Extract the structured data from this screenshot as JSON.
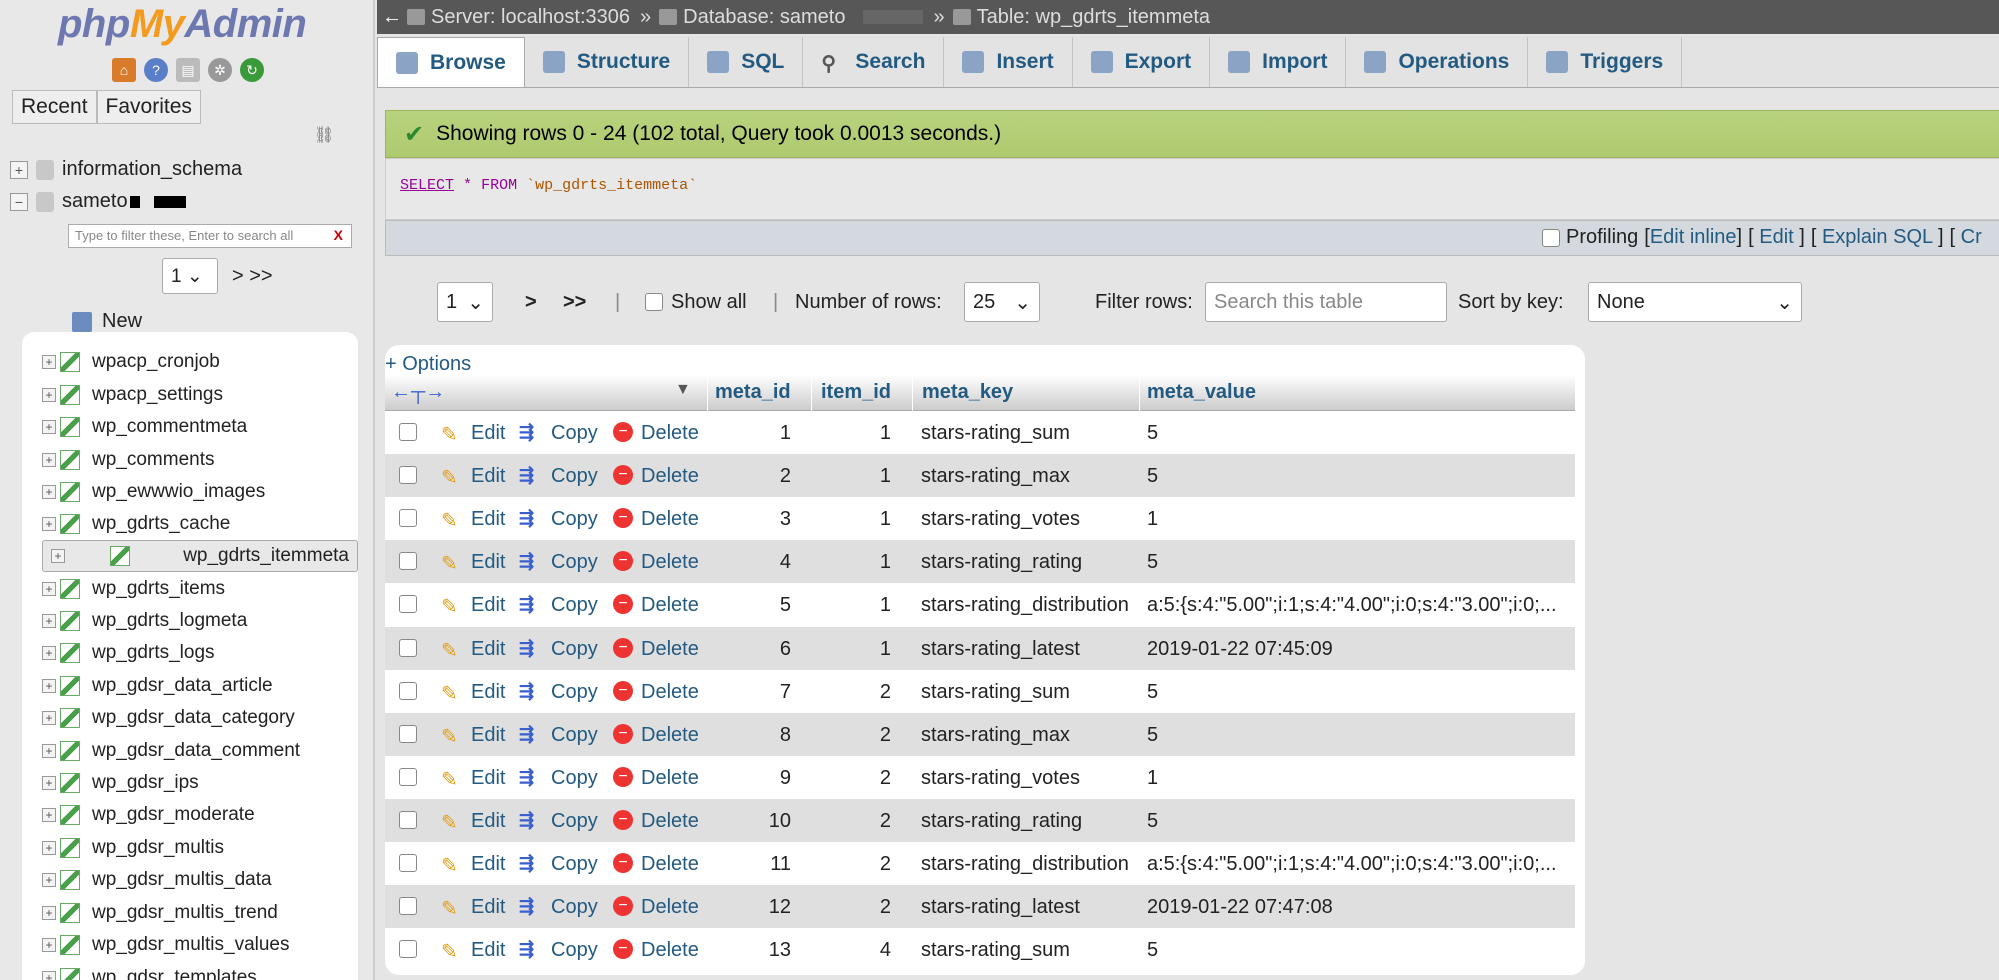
{
  "nav": {
    "logo": {
      "php": "php",
      "my": "My",
      "admin": "Admin"
    },
    "tabs": [
      "Recent",
      "Favorites"
    ],
    "databases": [
      {
        "name": "information_schema",
        "expander": "+"
      },
      {
        "name": "sameto",
        "expander": "−"
      }
    ],
    "filter_placeholder": "Type to filter these, Enter to search all",
    "filter_clear": "X",
    "page_select": "1",
    "page_next": "> >>",
    "new_label": "New",
    "tables": [
      "wpacp_cronjob",
      "wpacp_settings",
      "wp_commentmeta",
      "wp_comments",
      "wp_ewwwio_images",
      "wp_gdrts_cache",
      "wp_gdrts_itemmeta",
      "wp_gdrts_items",
      "wp_gdrts_logmeta",
      "wp_gdrts_logs",
      "wp_gdsr_data_article",
      "wp_gdsr_data_category",
      "wp_gdsr_data_comment",
      "wp_gdsr_ips",
      "wp_gdsr_moderate",
      "wp_gdsr_multis",
      "wp_gdsr_multis_data",
      "wp_gdsr_multis_trend",
      "wp_gdsr_multis_values",
      "wp_gdsr_templates"
    ],
    "selected_table_index": 6
  },
  "breadcrumb": {
    "back": "←",
    "server": "Server: localhost:3306",
    "database": "Database: sameto",
    "table": "Table: wp_gdrts_itemmeta",
    "sep": "»"
  },
  "tabs": [
    "Browse",
    "Structure",
    "SQL",
    "Search",
    "Insert",
    "Export",
    "Import",
    "Operations",
    "Triggers"
  ],
  "message": "Showing rows 0 - 24 (102 total, Query took 0.0013 seconds.)",
  "sql": {
    "select": "SELECT",
    "star": "*",
    "from": "FROM",
    "table": "`wp_gdrts_itemmeta`"
  },
  "profiling": {
    "label": "Profiling",
    "edit_inline": "Edit inline",
    "edit": "Edit",
    "explain": "Explain SQL",
    "create": "Cr"
  },
  "navigation": {
    "page": "1",
    "next": ">",
    "last": ">>",
    "show_all": "Show all",
    "num_rows_label": "Number of rows:",
    "num_rows_value": "25",
    "filter_label": "Filter rows:",
    "filter_placeholder": "Search this table",
    "sort_label": "Sort by key:",
    "sort_value": "None"
  },
  "results": {
    "options": "+ Options",
    "columns": [
      "meta_id",
      "item_id",
      "meta_key",
      "meta_value"
    ],
    "actions": {
      "edit": "Edit",
      "copy": "Copy",
      "delete": "Delete"
    },
    "rows": [
      [
        "1",
        "1",
        "stars-rating_sum",
        "5"
      ],
      [
        "2",
        "1",
        "stars-rating_max",
        "5"
      ],
      [
        "3",
        "1",
        "stars-rating_votes",
        "1"
      ],
      [
        "4",
        "1",
        "stars-rating_rating",
        "5"
      ],
      [
        "5",
        "1",
        "stars-rating_distribution",
        "a:5:{s:4:\"5.00\";i:1;s:4:\"4.00\";i:0;s:4:\"3.00\";i:0;..."
      ],
      [
        "6",
        "1",
        "stars-rating_latest",
        "2019-01-22 07:45:09"
      ],
      [
        "7",
        "2",
        "stars-rating_sum",
        "5"
      ],
      [
        "8",
        "2",
        "stars-rating_max",
        "5"
      ],
      [
        "9",
        "2",
        "stars-rating_votes",
        "1"
      ],
      [
        "10",
        "2",
        "stars-rating_rating",
        "5"
      ],
      [
        "11",
        "2",
        "stars-rating_distribution",
        "a:5:{s:4:\"5.00\";i:1;s:4:\"4.00\";i:0;s:4:\"3.00\";i:0;..."
      ],
      [
        "12",
        "2",
        "stars-rating_latest",
        "2019-01-22 07:47:08"
      ],
      [
        "13",
        "4",
        "stars-rating_sum",
        "5"
      ]
    ]
  },
  "colors": {
    "link": "#235a81",
    "success_bg": "#b2cc72",
    "topbar": "#575757"
  }
}
